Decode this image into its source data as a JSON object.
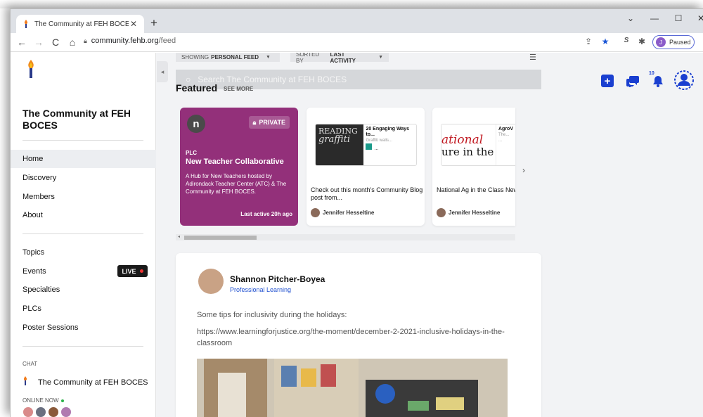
{
  "browser": {
    "tab_title": "The Community at FEH BOCES",
    "tab_close": "✕",
    "new_tab": "+",
    "url_host": "community.fehb.org",
    "url_path": "/feed",
    "profile_initial": "J",
    "profile_status": "Paused",
    "window_controls": [
      "⌄",
      "—",
      "☐",
      "✕"
    ]
  },
  "sidebar": {
    "community_title": "The Community at FEH BOCES",
    "nav_primary": [
      "Home",
      "Discovery",
      "Members",
      "About"
    ],
    "nav_secondary": [
      "Topics",
      "Events",
      "Specialties",
      "PLCs",
      "Poster Sessions"
    ],
    "live_label": "LIVE",
    "chat_label": "CHAT",
    "chat_item": "The Community at FEH BOCES",
    "online_label": "ONLINE NOW"
  },
  "filters": {
    "showing_prefix": "SHOWING",
    "showing_value": "PERSONAL FEED",
    "sorted_prefix": "SORTED BY",
    "sorted_value": "LAST ACTIVITY"
  },
  "search": {
    "placeholder": "Search The Community at FEH BOCES"
  },
  "featured": {
    "heading": "Featured",
    "see_more": "SEE MORE",
    "plc_card": {
      "logo_letter": "n",
      "private_label": "PRIVATE",
      "tag": "PLC",
      "name": "New Teacher Collaborative",
      "description": "A Hub for New Teachers hosted by Adirondack Teacher Center (ATC) & The Community at FEH BOCES.",
      "last_active": "Last active 20h ago"
    },
    "cards": [
      {
        "preview_title": "20 Engaging Ways to...",
        "preview_sub": "Graffiti walls...",
        "preview_extra": "...",
        "image_text_1": "READING",
        "image_text_2": "graffiti",
        "caption": "Check out this month's Community Blog post from...",
        "author": "Jennifer Hesseltine"
      },
      {
        "preview_title": "AgroV",
        "preview_sub": "The...",
        "preview_extra": "...",
        "image_text_1": "ational",
        "image_text_2": "ure in the",
        "caption": "National Ag in the Class Newsletter with ideas ar",
        "author": "Jennifer Hesseltine"
      }
    ]
  },
  "post": {
    "author": "Shannon Pitcher-Boyea",
    "group": "Professional Learning",
    "text": "Some tips for inclusivity during the holidays:",
    "link": "https://www.learningforjustice.org/the-moment/december-2-2021-inclusive-holidays-in-the-classroom"
  },
  "header_icons": {
    "notification_count": "10"
  },
  "colors": {
    "accent": "#1a3fd0",
    "plc_bg": "#93307a",
    "live_bg": "#1a1a1a"
  }
}
